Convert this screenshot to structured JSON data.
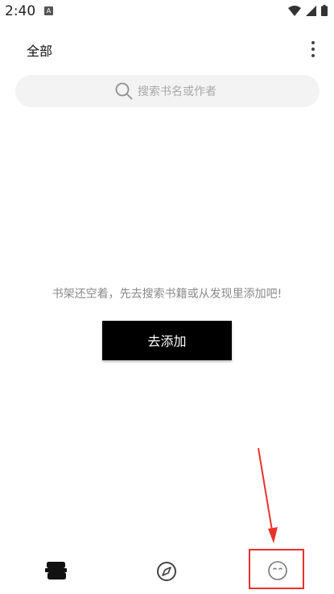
{
  "status_bar": {
    "time": "2:40",
    "app_icon_letter": "A",
    "icons": [
      "wifi-icon",
      "signal-icon",
      "battery-icon"
    ]
  },
  "header": {
    "title": "全部",
    "more_icon": "more-vert-icon"
  },
  "search": {
    "placeholder": "搜索书名或作者",
    "icon": "search-icon"
  },
  "empty_state": {
    "message": "书架还空着，先去搜索书籍或从发现里添加吧!",
    "add_button_label": "去添加"
  },
  "bottom_nav": {
    "items": [
      {
        "icon": "bookshelf-icon"
      },
      {
        "icon": "compass-icon"
      },
      {
        "icon": "profile-icon"
      }
    ]
  },
  "annotation": {
    "color": "#e8322a"
  },
  "colors": {
    "accent": "#000000",
    "search_bg": "#f3f3f3",
    "placeholder": "#a8a8a8",
    "muted_text": "#8a8a8a"
  }
}
